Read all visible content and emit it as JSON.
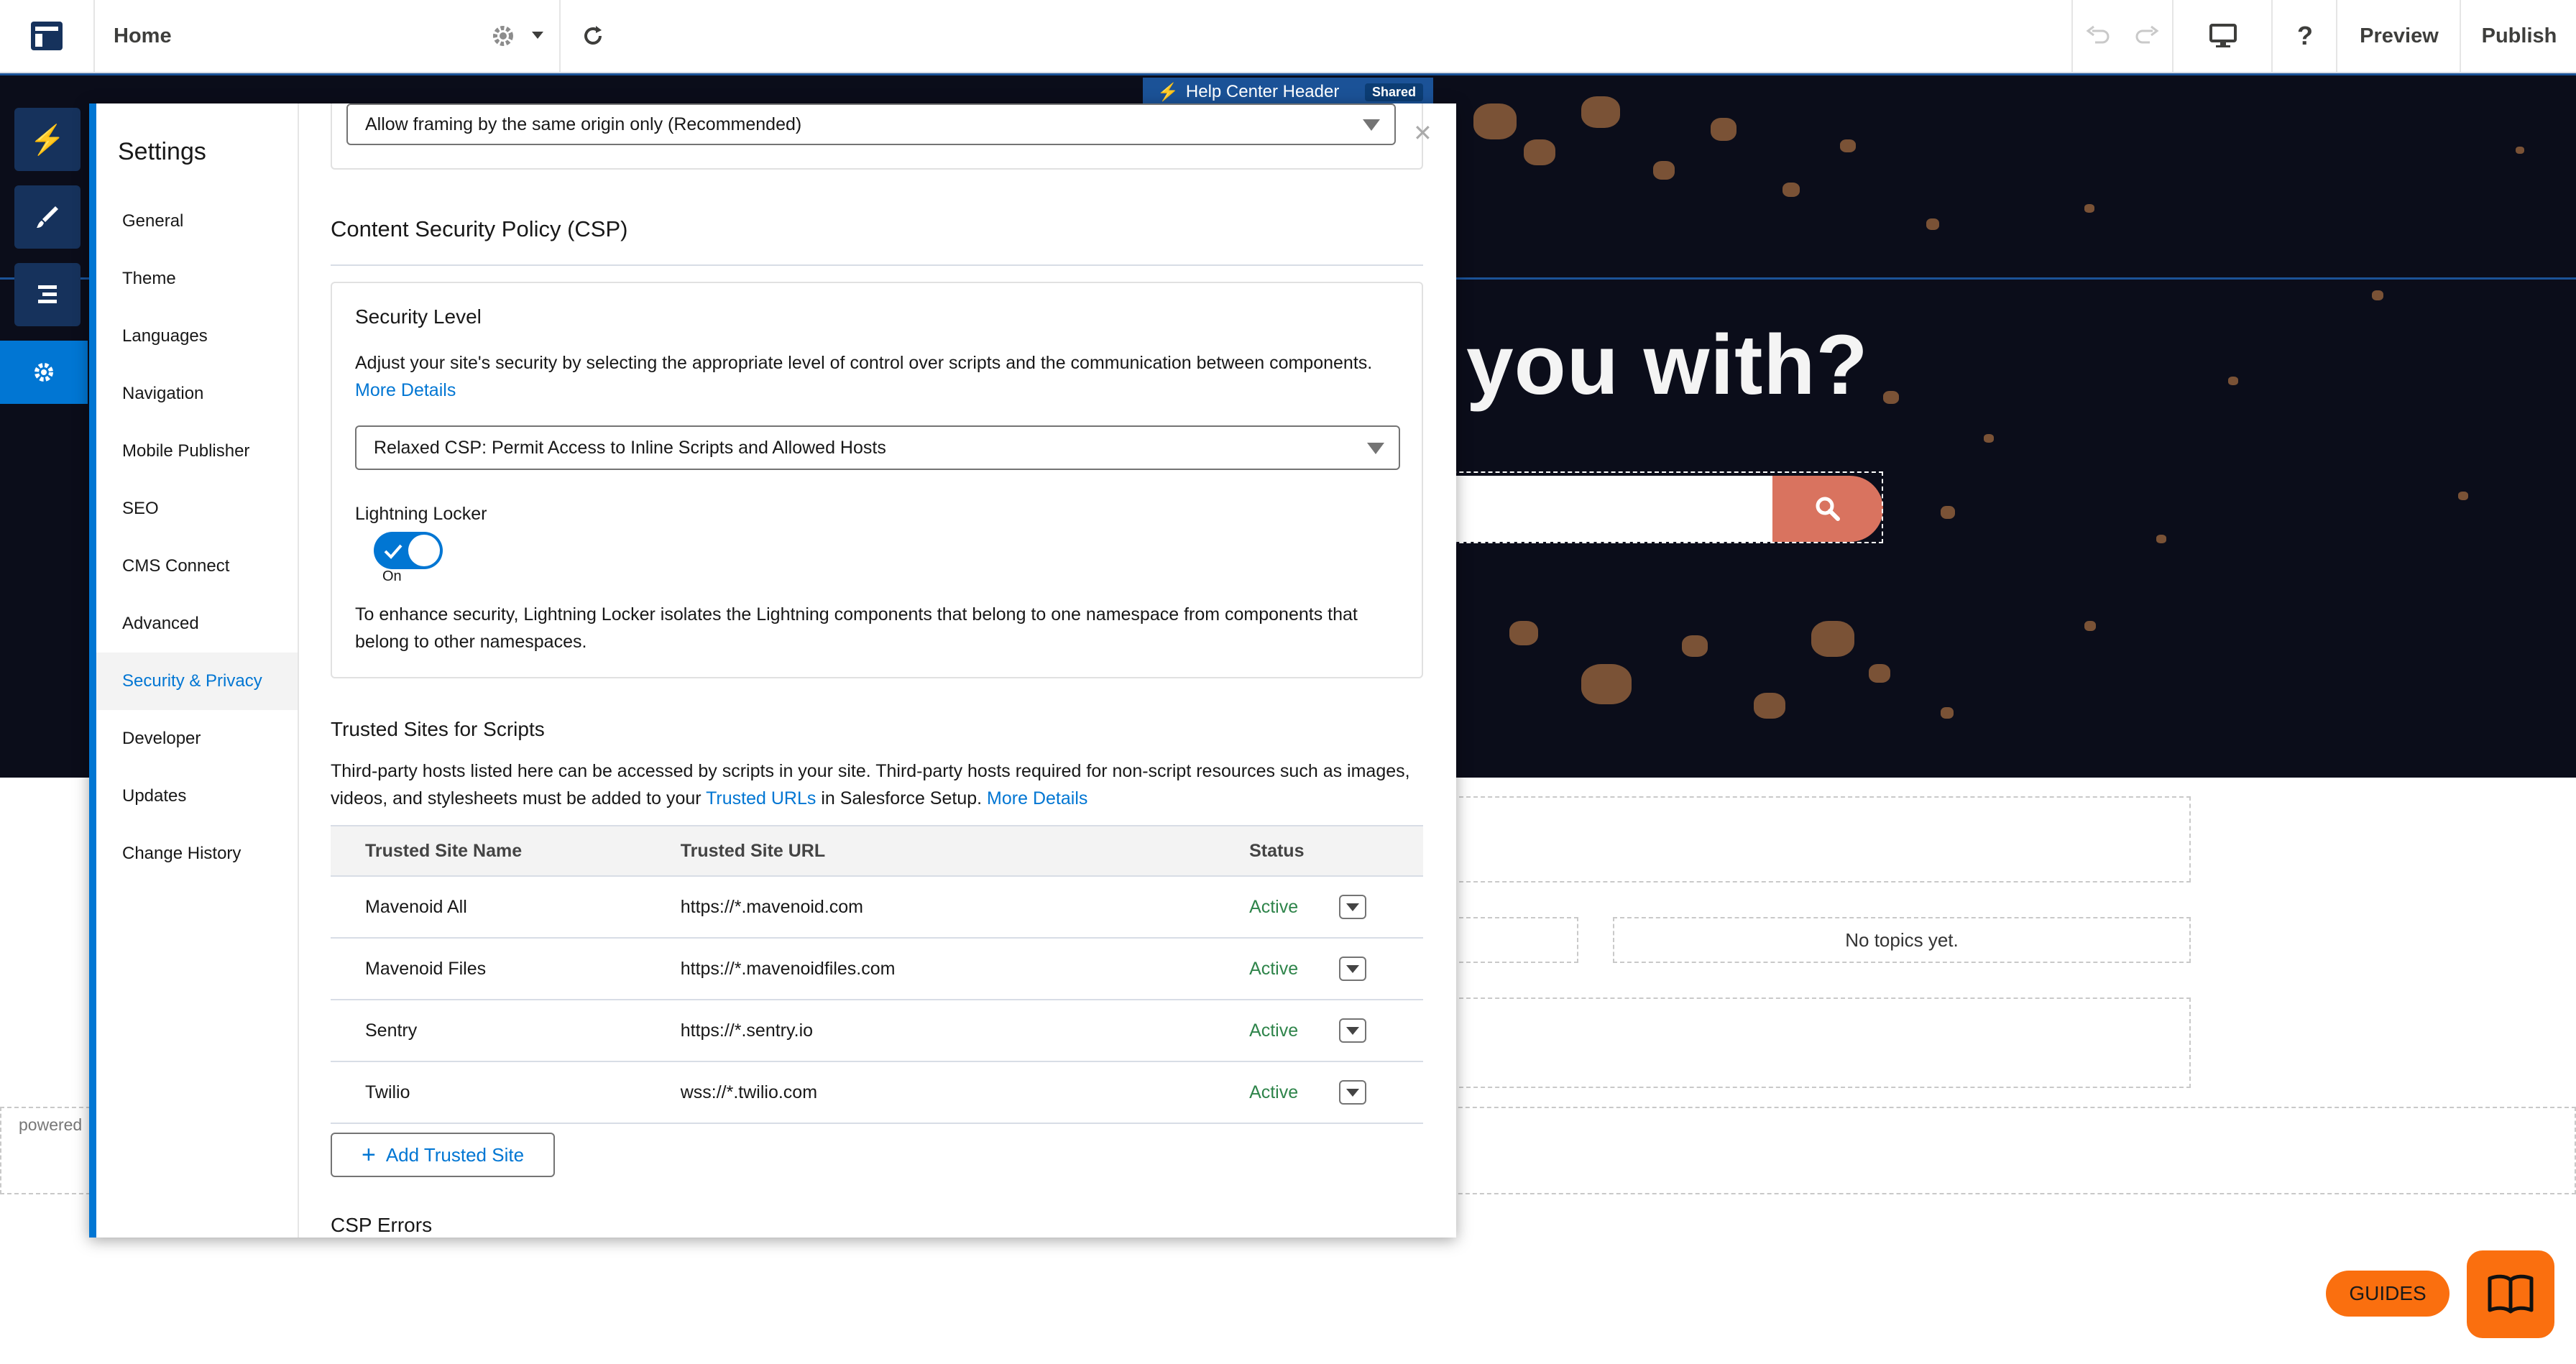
{
  "topbar": {
    "page_name": "Home",
    "preview_label": "Preview",
    "publish_label": "Publish"
  },
  "hero": {
    "component_label": "Help Center Header",
    "shared_badge": "Shared",
    "title_fragment": "you with?",
    "no_topics": "No topics yet.",
    "powered_fragment": "powered"
  },
  "settings": {
    "title": "Settings",
    "nav": [
      {
        "label": "General"
      },
      {
        "label": "Theme"
      },
      {
        "label": "Languages"
      },
      {
        "label": "Navigation"
      },
      {
        "label": "Mobile Publisher"
      },
      {
        "label": "SEO"
      },
      {
        "label": "CMS Connect"
      },
      {
        "label": "Advanced"
      },
      {
        "label": "Security & Privacy"
      },
      {
        "label": "Developer"
      },
      {
        "label": "Updates"
      },
      {
        "label": "Change History"
      }
    ],
    "selected_nav": "Security & Privacy",
    "framing_select_value": "Allow framing by the same origin only (Recommended)",
    "csp_heading": "Content Security Policy (CSP)",
    "security_level_label": "Security Level",
    "security_level_desc": "Adjust your site's security by selecting the appropriate level of control over scripts and the communication between components.",
    "more_details_1": "More Details",
    "security_level_value": "Relaxed CSP: Permit Access to Inline Scripts and Allowed Hosts",
    "locker_label": "Lightning Locker",
    "locker_state": "On",
    "locker_desc": "To enhance security, Lightning Locker isolates the Lightning components that belong to one namespace from components that belong to other namespaces.",
    "trusted_heading": "Trusted Sites for Scripts",
    "trusted_desc_1": "Third-party hosts listed here can be accessed by scripts in your site. Third-party hosts required for non-script resources such as images, videos, and stylesheets must be added to your",
    "trusted_urls_link": "Trusted URLs",
    "trusted_desc_2": "in Salesforce Setup.",
    "more_details_2": "More Details",
    "table": {
      "headers": [
        "Trusted Site Name",
        "Trusted Site URL",
        "Status"
      ],
      "rows": [
        {
          "name": "Mavenoid All",
          "url": "https://*.mavenoid.com",
          "status": "Active"
        },
        {
          "name": "Mavenoid Files",
          "url": "https://*.mavenoidfiles.com",
          "status": "Active"
        },
        {
          "name": "Sentry",
          "url": "https://*.sentry.io",
          "status": "Active"
        },
        {
          "name": "Twilio",
          "url": "wss://*.twilio.com",
          "status": "Active"
        }
      ]
    },
    "add_site_label": "Add Trusted Site",
    "csp_errors_heading": "CSP Errors"
  },
  "widgets": {
    "guides_label": "GUIDES"
  },
  "colors": {
    "accent": "#0176d3",
    "active_status": "#2e844a",
    "search_button": "#d9735f",
    "guides": "#fa6f0f"
  }
}
